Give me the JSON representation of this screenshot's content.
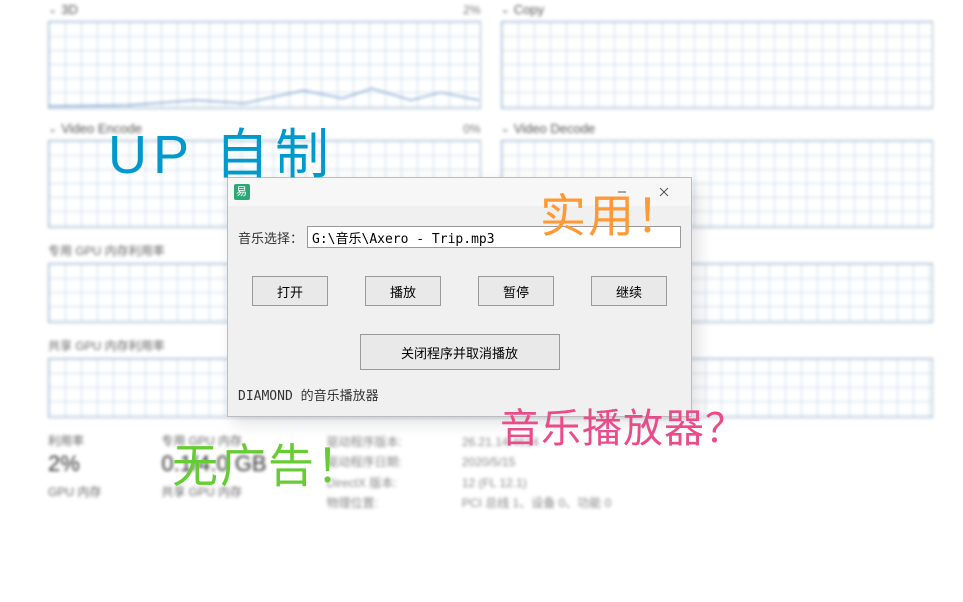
{
  "charts": {
    "row1": [
      {
        "name": "3D",
        "pct": "2%"
      },
      {
        "name": "Copy",
        "pct": ""
      }
    ],
    "row2": [
      {
        "name": "Video Encode",
        "pct": "0%"
      },
      {
        "name": "Video Decode",
        "pct": ""
      }
    ],
    "mem_dedicated_label": "专用 GPU 内存利用率",
    "mem_shared_label": "共享 GPU 内存利用率"
  },
  "stats": {
    "util_label": "利用率",
    "util_value": "2%",
    "ded_label": "专用 GPU 内存",
    "ded_value": "0.1/4.0 GB",
    "gpu_mem_label": "GPU 内存",
    "shared_label": "共享 GPU 内存",
    "info": {
      "driver_ver_label": "驱动程序版本:",
      "driver_ver": "26.21.14.4614",
      "driver_date_label": "驱动程序日期:",
      "driver_date": "2020/5/15",
      "dx_label": "DirectX 版本:",
      "dx": "12 (FL 12.1)",
      "loc_label": "物理位置:",
      "loc": "PCI 总线 1、设备 0、功能 0"
    }
  },
  "dialog": {
    "path_label": "音乐选择：",
    "path_value": "G:\\音乐\\Axero - Trip.mp3",
    "btn_open": "打开",
    "btn_play": "播放",
    "btn_pause": "暂停",
    "btn_resume": "继续",
    "btn_close_cancel": "关闭程序并取消播放",
    "status": "DIAMOND 的音乐播放器"
  },
  "annotations": {
    "top_left": "UP 自制",
    "orange": "实用！",
    "green": "无广告！",
    "pink": "音乐播放器？"
  }
}
